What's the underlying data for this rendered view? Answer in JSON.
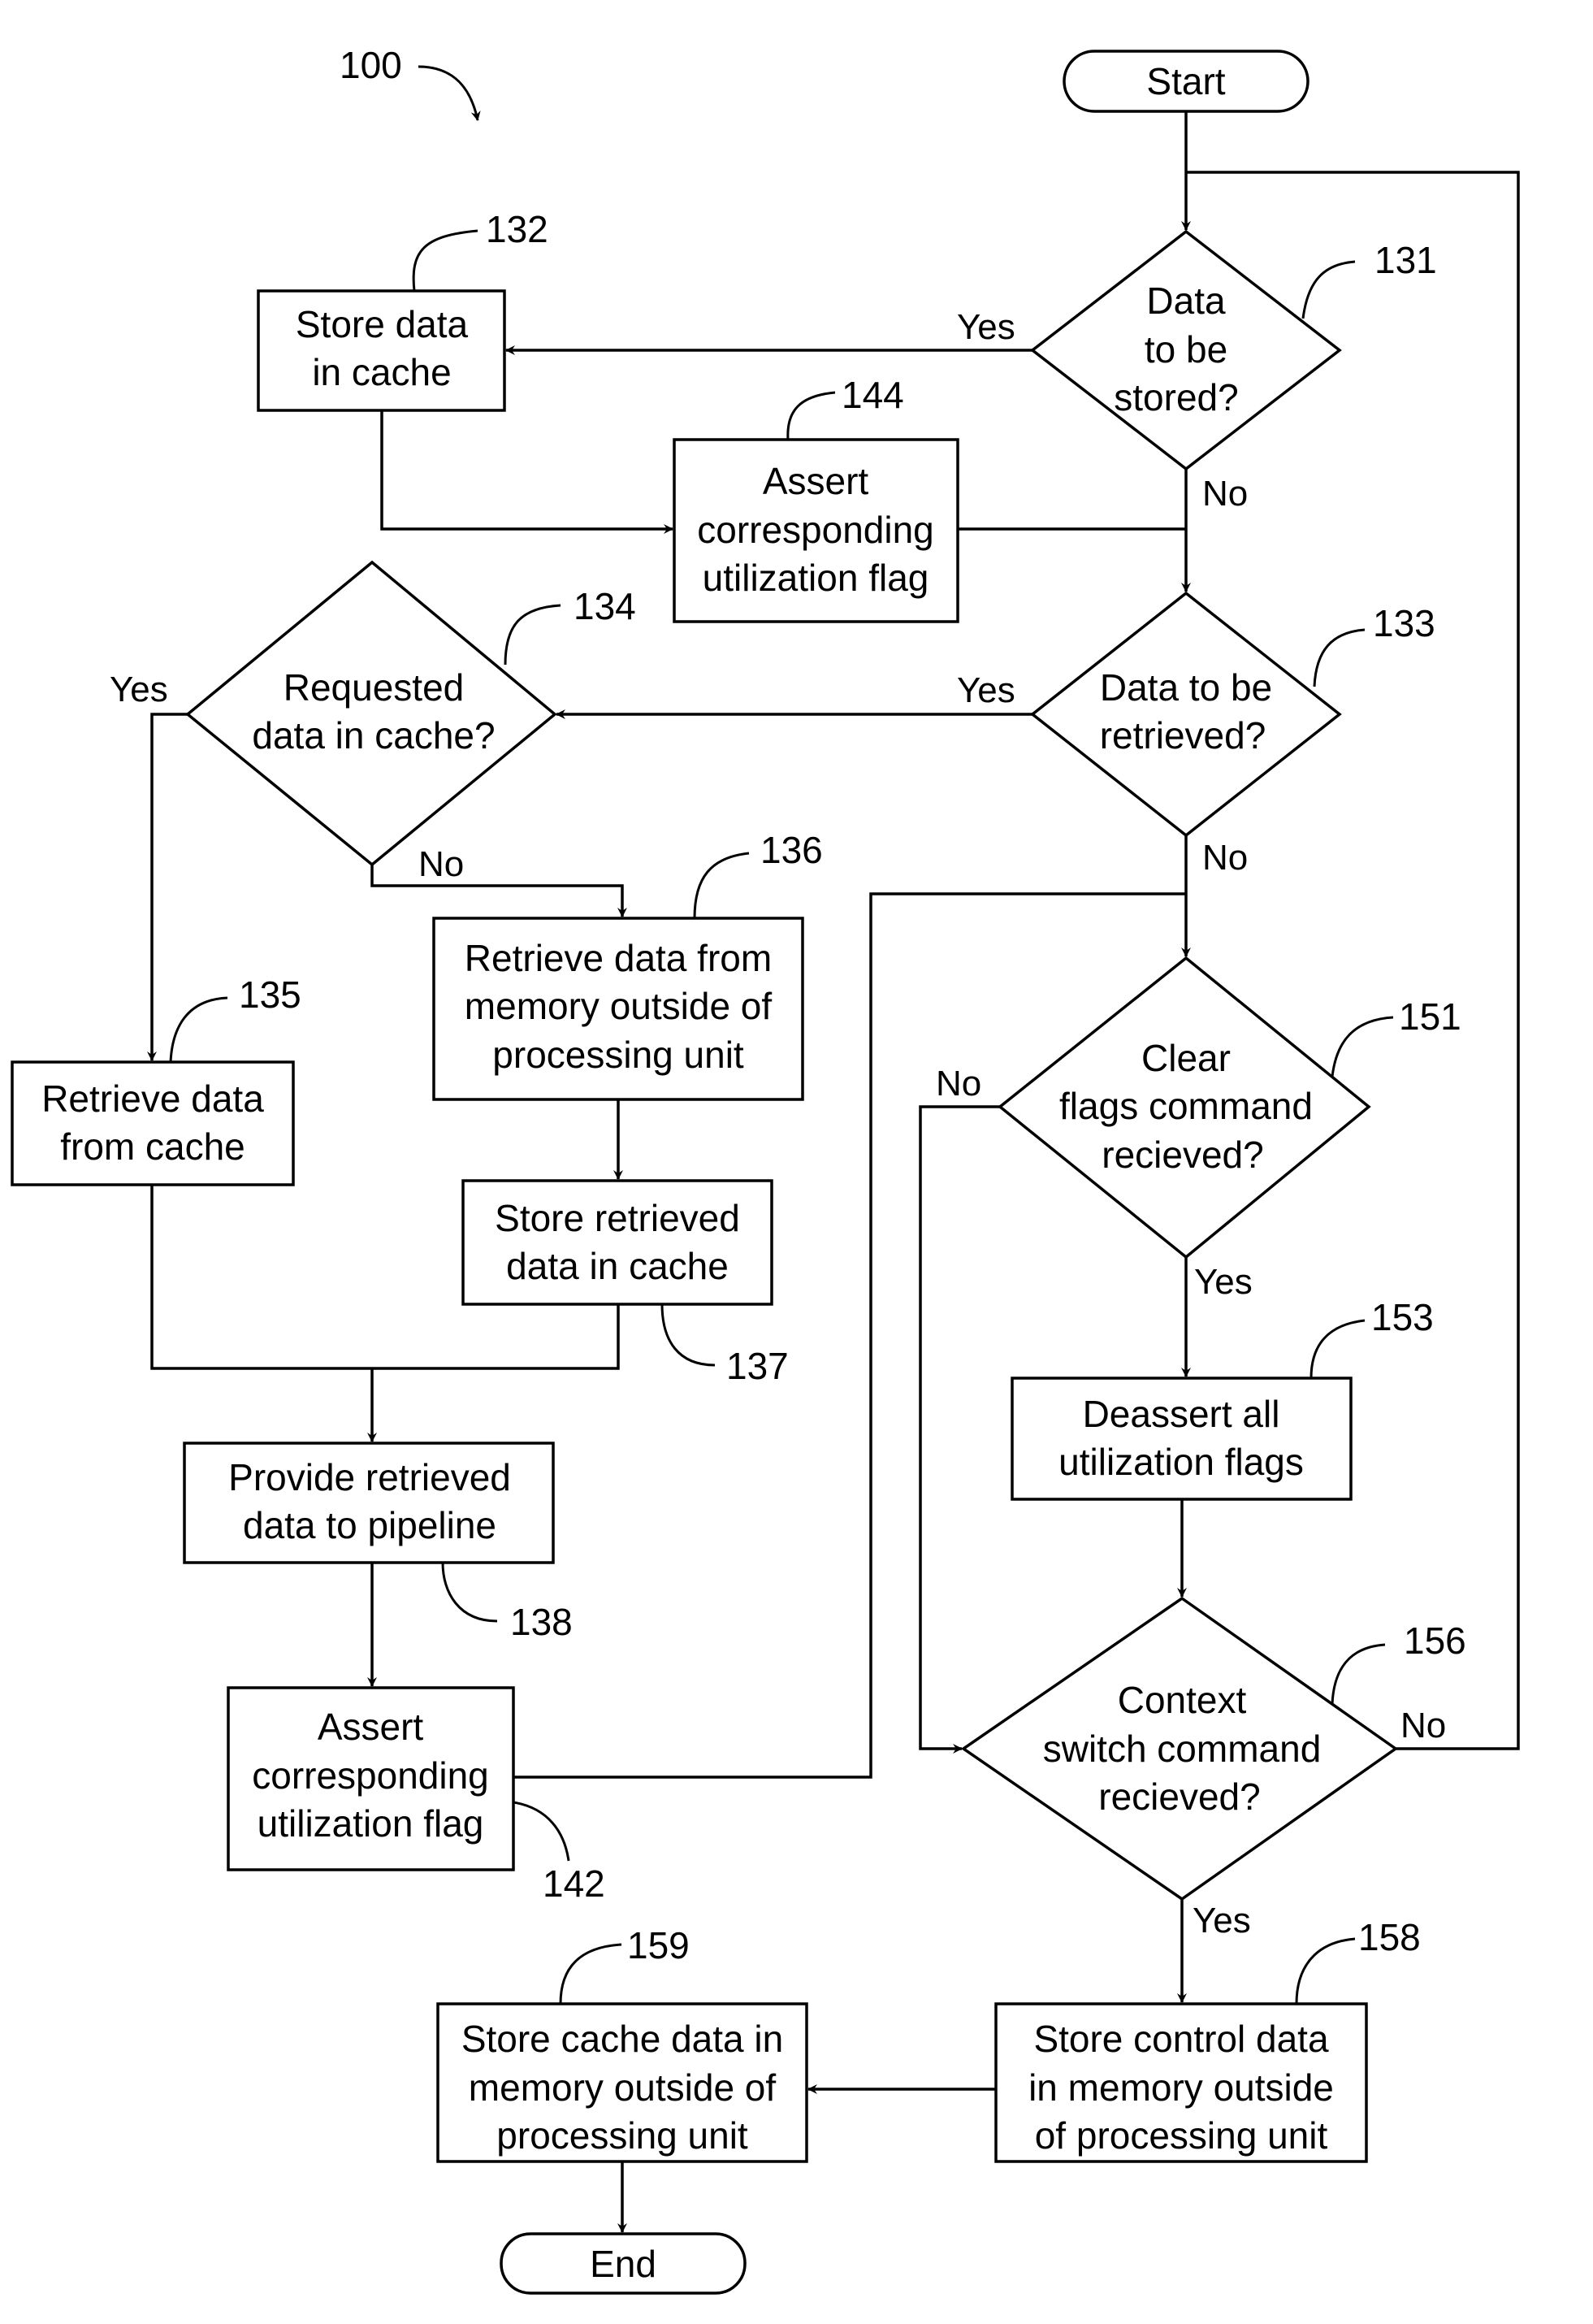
{
  "figure": {
    "reference": "100",
    "colors": {
      "stroke": "#000000",
      "background": "#ffffff"
    }
  },
  "terminals": {
    "start": "Start",
    "end": "End"
  },
  "nodes": {
    "n131": {
      "ref": "131",
      "lines": [
        "Data",
        "to be",
        "stored?"
      ],
      "type": "decision"
    },
    "n132": {
      "ref": "132",
      "lines": [
        "Store data",
        "in cache"
      ],
      "type": "process"
    },
    "n144": {
      "ref": "144",
      "lines": [
        "Assert",
        "corresponding",
        "utilization flag"
      ],
      "type": "process"
    },
    "n133": {
      "ref": "133",
      "lines": [
        "Data to be",
        "retrieved?"
      ],
      "type": "decision"
    },
    "n134": {
      "ref": "134",
      "lines": [
        "Requested",
        "data in cache?"
      ],
      "type": "decision"
    },
    "n135": {
      "ref": "135",
      "lines": [
        "Retrieve data",
        "from cache"
      ],
      "type": "process"
    },
    "n136": {
      "ref": "136",
      "lines": [
        "Retrieve data from",
        "memory outside of",
        "processing unit"
      ],
      "type": "process"
    },
    "n137": {
      "ref": "137",
      "lines": [
        "Store retrieved",
        "data in cache"
      ],
      "type": "process"
    },
    "n138": {
      "ref": "138",
      "lines": [
        "Provide retrieved",
        "data to pipeline"
      ],
      "type": "process"
    },
    "n142": {
      "ref": "142",
      "lines": [
        "Assert",
        "corresponding",
        "utilization flag"
      ],
      "type": "process"
    },
    "n151": {
      "ref": "151",
      "lines": [
        "Clear",
        "flags command",
        "recieved?"
      ],
      "type": "decision"
    },
    "n153": {
      "ref": "153",
      "lines": [
        "Deassert all",
        "utilization flags"
      ],
      "type": "process"
    },
    "n156": {
      "ref": "156",
      "lines": [
        "Context",
        "switch command",
        "recieved?"
      ],
      "type": "decision"
    },
    "n158": {
      "ref": "158",
      "lines": [
        "Store control data",
        "in memory outside",
        "of processing unit"
      ],
      "type": "process"
    },
    "n159": {
      "ref": "159",
      "lines": [
        "Store cache data in",
        "memory outside of",
        "processing unit"
      ],
      "type": "process"
    }
  },
  "branch_labels": {
    "b131_yes": "Yes",
    "b131_no": "No",
    "b133_yes": "Yes",
    "b133_no": "No",
    "b134_yes": "Yes",
    "b134_no": "No",
    "b151_no": "No",
    "b151_yes": "Yes",
    "b156_no": "No",
    "b156_yes": "Yes"
  }
}
